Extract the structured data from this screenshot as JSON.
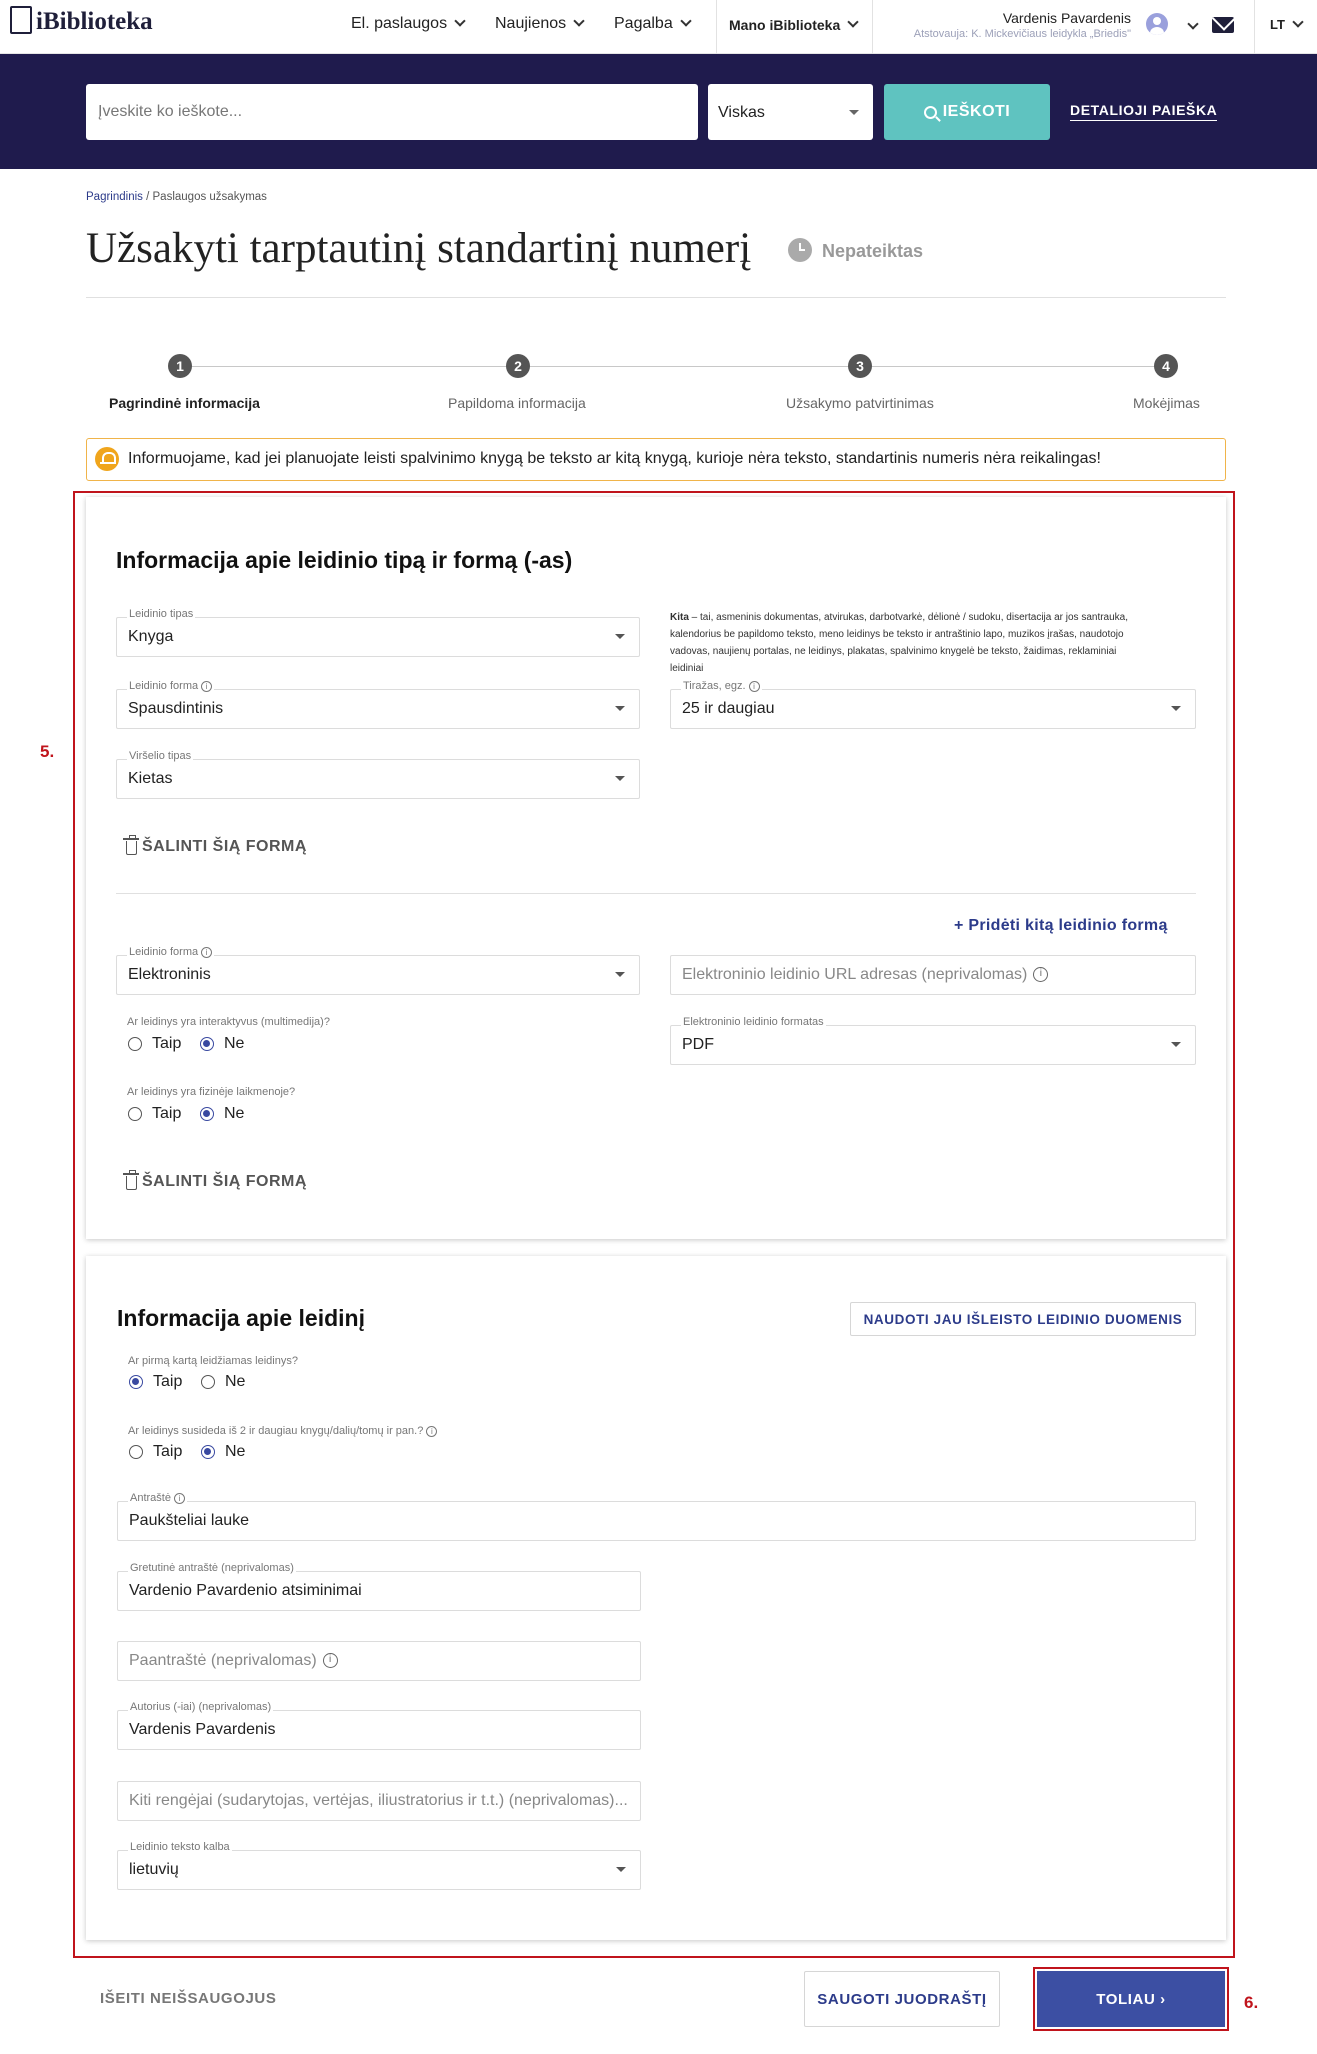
{
  "nav": {
    "logo": "iBiblioteka",
    "menu": [
      "El. paslaugos",
      "Naujienos",
      "Pagalba"
    ],
    "my_library": "Mano iBiblioteka",
    "user_name": "Vardenis Pavardenis",
    "user_represents": "Atstovauja: K. Mickevičiaus leidykla „Briedis\"",
    "language": "LT"
  },
  "search": {
    "placeholder": "Įveskite ko ieškote...",
    "scope": "Viskas",
    "button": "IEŠKOTI",
    "advanced": "DETALIOJI PAIEŠKA"
  },
  "breadcrumb": {
    "home": "Pagrindinis",
    "separator": "/",
    "current": "Paslaugos užsakymas"
  },
  "page": {
    "title": "Užsakyti tarptautinį standartinį numerį",
    "status": "Nepateiktas"
  },
  "steps": [
    {
      "num": "1",
      "label": "Pagrindinė informacija"
    },
    {
      "num": "2",
      "label": "Papildoma informacija"
    },
    {
      "num": "3",
      "label": "Užsakymo patvirtinimas"
    },
    {
      "num": "4",
      "label": "Mokėjimas"
    }
  ],
  "alert": "Informuojame, kad jei planuojate leisti spalvinimo knygą be teksto ar kitą knygą, kurioje nėra teksto, standartinis numeris nėra reikalingas!",
  "annotations": {
    "box5": "5.",
    "box6": "6."
  },
  "type_card": {
    "title": "Informacija apie leidinio tipą ir formą (-as)",
    "type": {
      "label": "Leidinio tipas",
      "value": "Knyga"
    },
    "note_bold": "Kita",
    "note_lines": [
      " – tai, asmeninis dokumentas, atvirukas, darbotvarkė, dėlionė / sudoku, disertacija ar jos santrauka,",
      "kalendorius be papildomo teksto, meno leidinys be teksto ir antraštinio lapo, muzikos įrašas, naudotojo",
      "vadovas, naujienų portalas, ne leidinys, plakatas, spalvinimo knygelė be teksto, žaidimas, reklaminiai",
      "leidiniai"
    ],
    "form1": {
      "label": "Leidinio forma",
      "value": "Spausdintinis"
    },
    "print_run": {
      "label": "Tiražas, egz.",
      "value": "25 ir daugiau"
    },
    "cover": {
      "label": "Viršelio tipas",
      "value": "Kietas"
    },
    "remove1": "ŠALINTI ŠIĄ FORMĄ",
    "add_form": "Pridėti kitą leidinio formą",
    "form2": {
      "label": "Leidinio forma",
      "value": "Elektroninis"
    },
    "url_placeholder": "Elektroninio leidinio URL adresas (neprivalomas)",
    "interactive": {
      "question": "Ar leidinys yra interaktyvus (multimedija)?",
      "yes": "Taip",
      "no": "Ne"
    },
    "format": {
      "label": "Elektroninio leidinio formatas",
      "value": "PDF"
    },
    "physical": {
      "question": "Ar leidinys yra fizinėje laikmenoje?",
      "yes": "Taip",
      "no": "Ne"
    },
    "remove2": "ŠALINTI ŠIĄ FORMĄ"
  },
  "pub_card": {
    "title": "Informacija apie leidinį",
    "use_existing": "NAUDOTI JAU IŠLEISTO LEIDINIO DUOMENIS",
    "first_time": {
      "question": "Ar pirmą kartą leidžiamas leidinys?",
      "yes": "Taip",
      "no": "Ne"
    },
    "multi": {
      "question": "Ar leidinys susideda iš 2 ir daugiau knygų/dalių/tomų ir pan.?",
      "yes": "Taip",
      "no": "Ne"
    },
    "title_field": {
      "label": "Antraštė",
      "value": "Paukšteliai lauke"
    },
    "parallel": {
      "label": "Gretutinė antraštė (neprivalomas)",
      "value": "Vardenio Pavardenio atsiminimai"
    },
    "subtitle_placeholder": "Paantraštė (neprivalomas)",
    "author": {
      "label": "Autorius (-iai) (neprivalomas)",
      "value": "Vardenis Pavardenis"
    },
    "others_placeholder": "Kiti rengėjai (sudarytojas, vertėjas, iliustratorius ir t.t.) (neprivalomas)...",
    "language": {
      "label": "Leidinio teksto kalba",
      "value": "lietuvių"
    }
  },
  "footer": {
    "exit": "IŠEITI NEIŠSAUGOJUS",
    "save": "SAUGOTI JUODRAŠTĮ",
    "next": "TOLIAU"
  }
}
